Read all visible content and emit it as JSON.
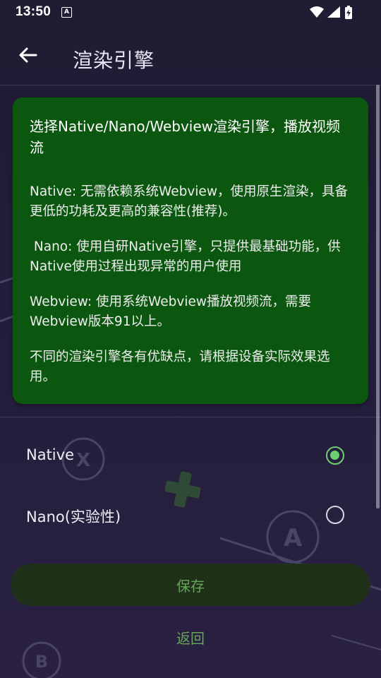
{
  "status_bar": {
    "time": "13:50",
    "notification_icon_letter": "A",
    "icons": [
      "wifi-icon",
      "signal-icon",
      "battery-charging-icon"
    ]
  },
  "app_bar": {
    "title": "渲染引擎",
    "back_icon": "arrow-left-icon"
  },
  "info_card": {
    "heading": "选择Native/Nano/Webview渲染引擎，播放视频流",
    "paragraphs": [
      "Native: 无需依赖系统Webview，使用原生渲染，具备更低的功耗及更高的兼容性(推荐)。",
      " Nano: 使用自研Native引擎，只提供最基础功能，供Native使用过程出现异常的用户使用",
      "Webview: 使用系统Webview播放视频流，需要Webview版本91以上。",
      "不同的渲染引擎各有优缺点，请根据设备实际效果选用。"
    ],
    "background_color": "#0c5710"
  },
  "options": [
    {
      "label": "Native",
      "checked": true
    },
    {
      "label": "Nano(实验性)",
      "checked": false
    }
  ],
  "actions": {
    "save_label": "保存",
    "return_label": "返回"
  },
  "decorations": {
    "controller_letters": [
      "X",
      "A",
      "B"
    ]
  },
  "colors": {
    "accent": "#6fcd74",
    "button_text": "#6aa35f",
    "background": "#1f1c33"
  }
}
